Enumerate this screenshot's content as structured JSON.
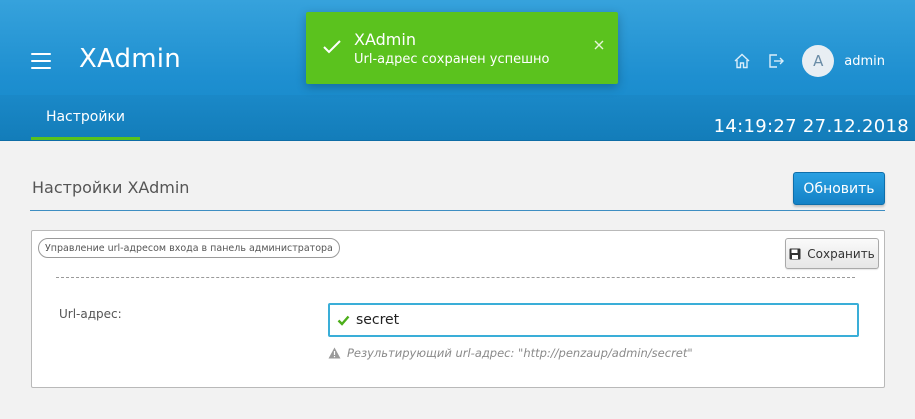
{
  "app": {
    "title": "XAdmin"
  },
  "header": {
    "username": "admin",
    "avatar_letter": "A",
    "nav_tab": "Настройки",
    "datetime": "14:19:27  27.12.2018",
    "icons": [
      "home-icon",
      "logout-icon"
    ]
  },
  "toast": {
    "title": "XAdmin",
    "message": "Url-адрес сохранен успешно",
    "color": "#5bc21e"
  },
  "page": {
    "title": "Настройки XAdmin",
    "update_button": "Обновить"
  },
  "panel": {
    "legend": "Управление url-адресом входа в панель администратора",
    "save_button": "Сохранить",
    "field_label": "Url-адрес:",
    "field_value": "secret",
    "hint": "Результирующий url-адрес: \"http://penzaup/admin/secret\""
  },
  "colors": {
    "header": "#1e8fd0",
    "accent_green": "#58c21e",
    "input_border": "#3aaed8"
  }
}
